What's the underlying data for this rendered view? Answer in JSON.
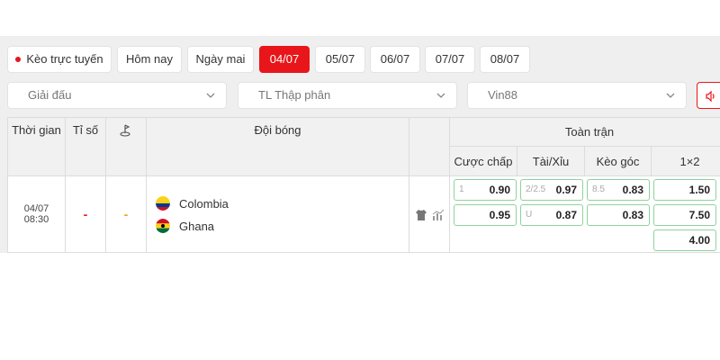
{
  "tabs": [
    {
      "label": "Kèo trực tuyến",
      "live": true,
      "active": false
    },
    {
      "label": "Hôm nay",
      "active": false
    },
    {
      "label": "Ngày mai",
      "active": false
    },
    {
      "label": "04/07",
      "active": true
    },
    {
      "label": "05/07",
      "active": false
    },
    {
      "label": "06/07",
      "active": false
    },
    {
      "label": "07/07",
      "active": false
    },
    {
      "label": "08/07",
      "active": false
    }
  ],
  "filters": {
    "league": "Giải đấu",
    "odds_format": "TL Thập phân",
    "bookmaker": "Vin88"
  },
  "table": {
    "headers": {
      "time": "Thời gian",
      "score": "Tỉ số",
      "team": "Đội bóng",
      "full_match": "Toàn trận",
      "handicap": "Cược chấp",
      "over_under": "Tài/Xỉu",
      "corners": "Kèo góc",
      "one_x_two": "1×2"
    },
    "match": {
      "date": "04/07",
      "time": "08:30",
      "score": "-",
      "corner_score": "-",
      "home": "Colombia",
      "away": "Ghana",
      "handicap": [
        {
          "line": "1",
          "value": "0.90"
        },
        {
          "line": "",
          "value": "0.95"
        }
      ],
      "over_under": [
        {
          "line": "2/2.5",
          "value": "0.97"
        },
        {
          "line": "U",
          "value": "0.87"
        }
      ],
      "corners": [
        {
          "line": "8.5",
          "value": "0.83"
        },
        {
          "line": "",
          "value": "0.83"
        }
      ],
      "one_x_two": [
        "1.50",
        "7.50",
        "4.00"
      ]
    }
  },
  "colors": {
    "accent": "#e8161b",
    "odds_border": "#8fd19e",
    "panel_bg": "#efefef"
  }
}
